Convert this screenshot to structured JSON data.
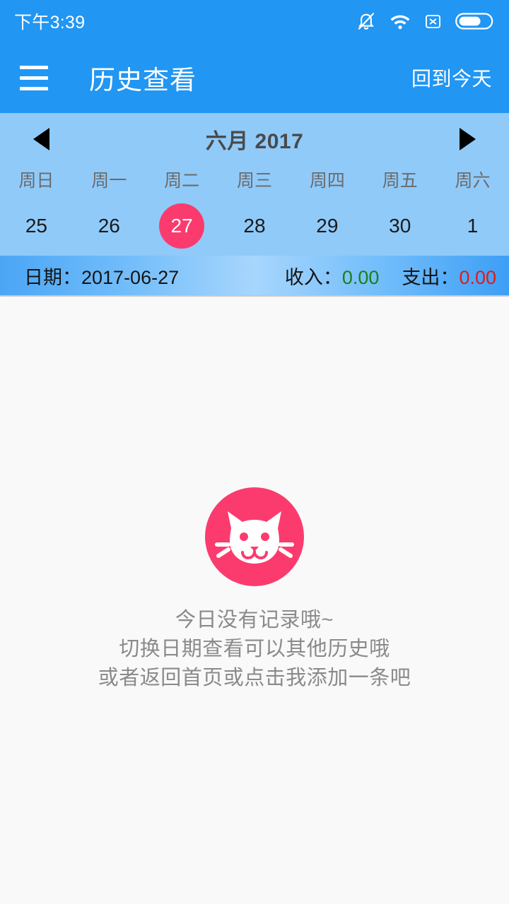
{
  "status_bar": {
    "time": "下午3:39",
    "icons": [
      "bell-muted-icon",
      "wifi-icon",
      "no-sim-icon",
      "battery-icon"
    ]
  },
  "app_bar": {
    "menu_icon": "hamburger-menu-icon",
    "title": "历史查看",
    "action_label": "回到今天"
  },
  "calendar": {
    "prev_icon": "triangle-left-icon",
    "next_icon": "triangle-right-icon",
    "month_label": "六月 2017",
    "weekdays": [
      "周日",
      "周一",
      "周二",
      "周三",
      "周四",
      "周五",
      "周六"
    ],
    "days": [
      {
        "label": "25",
        "selected": false
      },
      {
        "label": "26",
        "selected": false
      },
      {
        "label": "27",
        "selected": true
      },
      {
        "label": "28",
        "selected": false
      },
      {
        "label": "29",
        "selected": false
      },
      {
        "label": "30",
        "selected": false
      },
      {
        "label": "1",
        "selected": false
      }
    ]
  },
  "summary": {
    "date_text": "日期：2017-06-27",
    "income_label": "收入：",
    "income_value": "0.00",
    "expense_label": "支出：",
    "expense_value": "0.00"
  },
  "empty_state": {
    "logo_icon": "cat-face-icon",
    "line1": "今日没有记录哦~",
    "line2": "切换日期查看可以其他历史哦",
    "line3": "或者返回首页或点击我添加一条吧"
  },
  "colors": {
    "primary_blue": "#2196F3",
    "calendar_blue": "#90CAF9",
    "accent_pink": "#FB3B6E",
    "income_green": "#1B7F1B",
    "expense_red": "#E01B1B",
    "content_bg": "#F9F9F9"
  }
}
